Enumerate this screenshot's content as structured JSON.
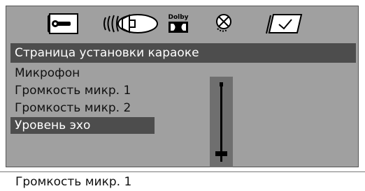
{
  "icons": [
    {
      "name": "setup-wrench-icon"
    },
    {
      "name": "speaker-audio-icon"
    },
    {
      "name": "dolby-logo-icon",
      "text": "Dolby"
    },
    {
      "name": "disc-icon"
    },
    {
      "name": "checkbox-preference-icon"
    }
  ],
  "page_title": "Страница установки караоке",
  "menu_items": [
    {
      "label": "Микрофон"
    },
    {
      "label": "Громкость микр. 1"
    },
    {
      "label": "Громкость микр. 2"
    },
    {
      "label": "Уровень эхо"
    }
  ],
  "selected_index": 3,
  "slider": {
    "level": 0.08
  },
  "status_text": "Громкость микр. 1",
  "colors": {
    "panel": "#a0a0a0",
    "highlight": "#4d4d4d",
    "slider_bg": "#6f6f6f"
  }
}
